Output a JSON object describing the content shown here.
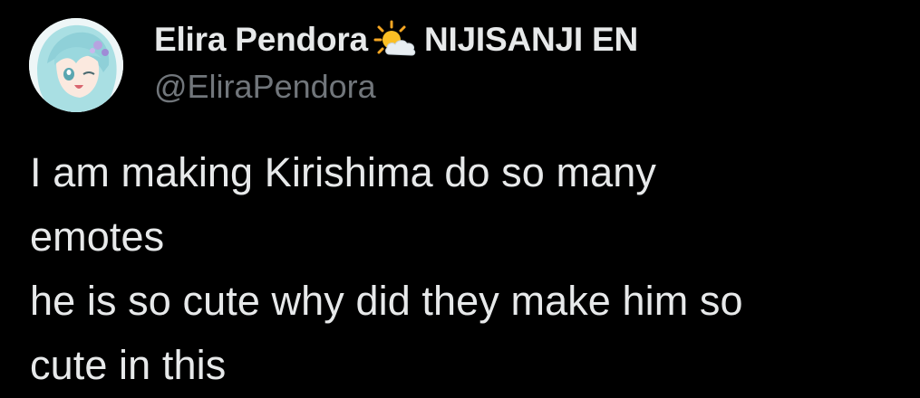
{
  "author": {
    "display_name": "Elira Pendora",
    "affiliation": "NIJISANJI EN",
    "handle": "@EliraPendora",
    "badge_icon": "sun-behind-cloud-icon"
  },
  "tweet": {
    "lines": [
      "I am making Kirishima do so many",
      "emotes",
      "he is so cute why did they make him so",
      "cute in this"
    ]
  },
  "colors": {
    "background": "#000000",
    "primary_text": "#e7e9ea",
    "secondary_text": "#71767b"
  }
}
